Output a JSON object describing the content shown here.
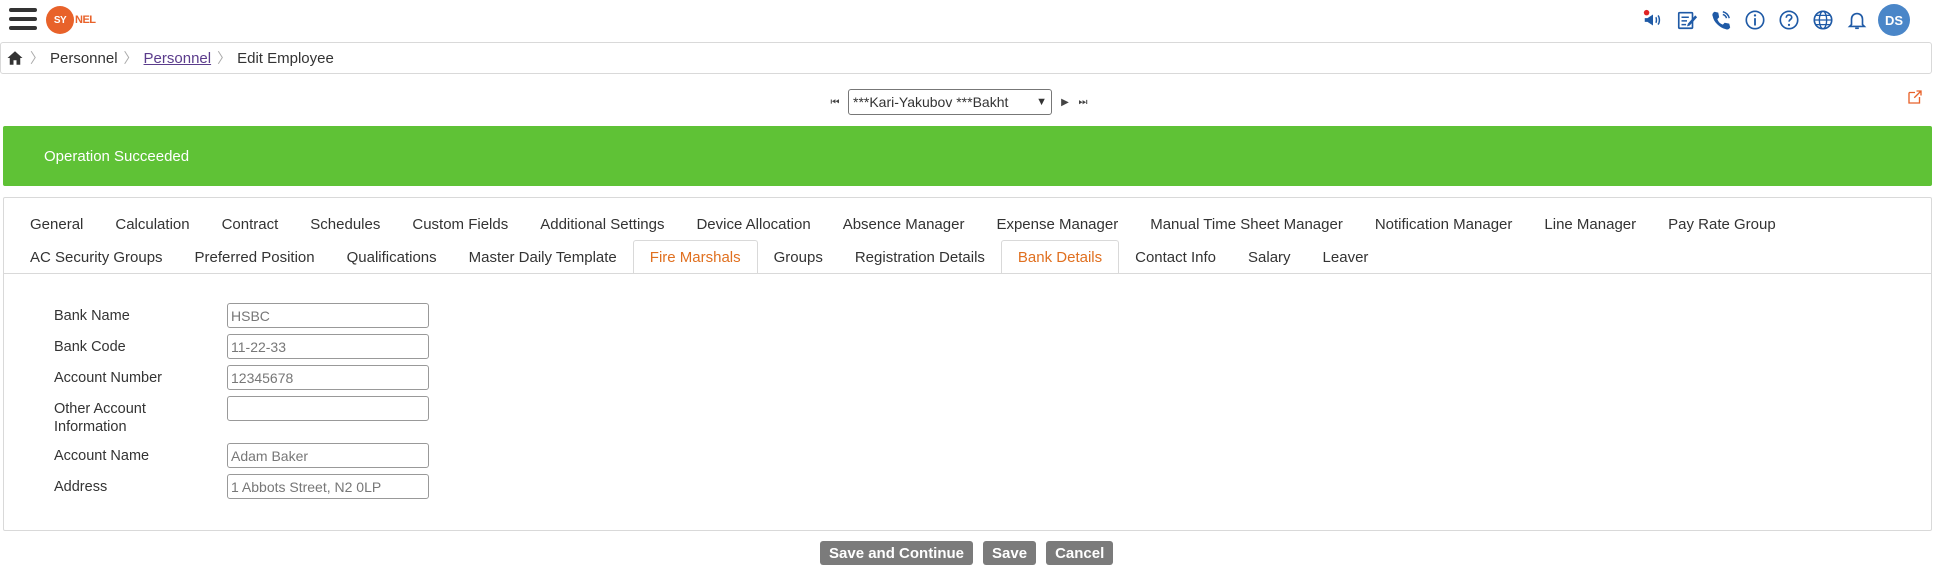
{
  "header": {
    "logo_text": "SY",
    "logo_suffix": "NEL",
    "icons": [
      "megaphone-icon",
      "edit-form-icon",
      "phone-icon",
      "info-icon",
      "help-icon",
      "globe-icon",
      "bell-icon"
    ],
    "avatar_initials": "DS",
    "avatar_color": "#4a86c8",
    "notification_dot_color": "#e02424"
  },
  "breadcrumb": {
    "items": [
      "Personnel",
      "Personnel",
      "Edit Employee"
    ]
  },
  "employee_selector": {
    "selected": "***Kari-Yakubov ***Bakht"
  },
  "banner": {
    "message": "Operation Succeeded",
    "color": "#5fc236"
  },
  "tabs": {
    "row1": [
      "General",
      "Calculation",
      "Contract",
      "Schedules",
      "Custom Fields",
      "Additional Settings",
      "Device Allocation",
      "Absence Manager",
      "Expense Manager",
      "Manual Time Sheet Manager",
      "Notification Manager",
      "Line Manager",
      "Pay Rate Group"
    ],
    "row2": [
      "AC Security Groups",
      "Preferred Position",
      "Qualifications",
      "Master Daily Template",
      "Fire Marshals",
      "Groups",
      "Registration Details",
      "Bank Details",
      "Contact Info",
      "Salary",
      "Leaver"
    ],
    "active": "Bank Details",
    "accent_color": "#e07020"
  },
  "form": {
    "bank_name": {
      "label": "Bank Name",
      "value": "HSBC"
    },
    "bank_code": {
      "label": "Bank Code",
      "value": "11-22-33"
    },
    "account_number": {
      "label": "Account Number",
      "value": "12345678"
    },
    "other_account_info": {
      "label_line1": "Other Account",
      "label_line2": "Information",
      "value": ""
    },
    "account_name": {
      "label": "Account Name",
      "value": "Adam Baker"
    },
    "address": {
      "label": "Address",
      "value": "1 Abbots Street, N2 0LP"
    }
  },
  "actions": {
    "save_continue": "Save and Continue",
    "save": "Save",
    "cancel": "Cancel"
  }
}
